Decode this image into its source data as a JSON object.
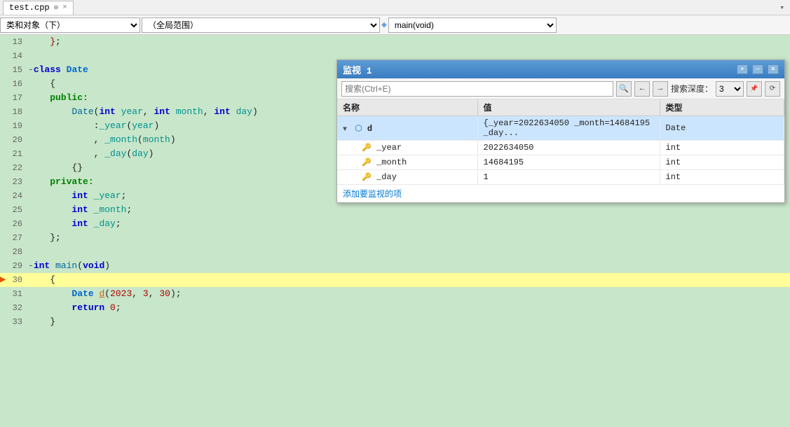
{
  "titlebar": {
    "tab_label": "test.cpp",
    "tab_pin": "⊕",
    "tab_close": "×",
    "scroll_indicator": "▾"
  },
  "toolbar": {
    "class_select_label": "类和对象（下）",
    "scope_select_label": "（全局范围）",
    "scope_icon": "⊞",
    "function_select_label": "main(void)",
    "function_icon": "◈"
  },
  "code": {
    "lines": [
      {
        "num": "13",
        "text": "    };"
      },
      {
        "num": "14",
        "text": ""
      },
      {
        "num": "15",
        "text": "-class Date",
        "class": "class-def"
      },
      {
        "num": "16",
        "text": "    {"
      },
      {
        "num": "17",
        "text": "    public:",
        "class": "access"
      },
      {
        "num": "18",
        "text": "        Date(int year, int month, int day)",
        "class": "constructor"
      },
      {
        "num": "19",
        "text": "            :_year(year)",
        "class": "init"
      },
      {
        "num": "20",
        "text": "            , _month(month)",
        "class": "init"
      },
      {
        "num": "21",
        "text": "            , _day(day)",
        "class": "init"
      },
      {
        "num": "22",
        "text": "        {}"
      },
      {
        "num": "23",
        "text": "    private:",
        "class": "access"
      },
      {
        "num": "24",
        "text": "        int _year;",
        "class": "member"
      },
      {
        "num": "25",
        "text": "        int _month;",
        "class": "member"
      },
      {
        "num": "26",
        "text": "        int _day;",
        "class": "member"
      },
      {
        "num": "27",
        "text": "    };"
      },
      {
        "num": "28",
        "text": ""
      },
      {
        "num": "29",
        "text": "-int main(void)",
        "class": "main-def"
      },
      {
        "num": "30",
        "text": "    {",
        "active": true
      },
      {
        "num": "31",
        "text": "        Date d(2023, 3, 30);",
        "class": "code-line-content highlighted"
      },
      {
        "num": "32",
        "text": "        return 0;"
      },
      {
        "num": "33",
        "text": "    }"
      }
    ]
  },
  "watch": {
    "title": "监视 1",
    "search_placeholder": "搜索(Ctrl+E)",
    "depth_label": "搜索深度：",
    "depth_value": "3",
    "columns": [
      "名称",
      "值",
      "类型"
    ],
    "rows": [
      {
        "name": "d",
        "value": "{_year=2022634050 _month=14684195 _day...",
        "type": "Date",
        "expanded": true,
        "is_object": true,
        "selected": true
      },
      {
        "name": "_year",
        "value": "2022634050",
        "type": "int",
        "indent": 1,
        "is_field": true
      },
      {
        "name": "_month",
        "value": "14684195",
        "type": "int",
        "indent": 1,
        "is_field": true
      },
      {
        "name": "_day",
        "value": "1",
        "type": "int",
        "indent": 1,
        "is_field": true
      }
    ],
    "add_watch_label": "添加要监视的项"
  }
}
